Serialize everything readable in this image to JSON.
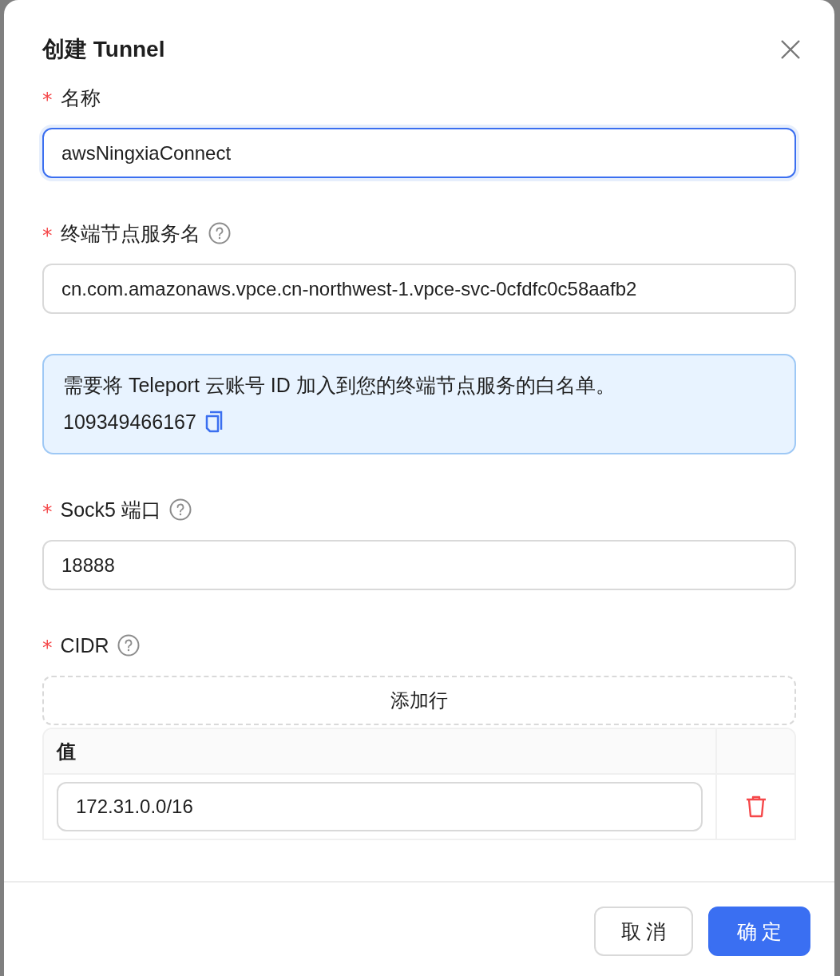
{
  "dialog": {
    "title": "创建 Tunnel"
  },
  "form": [
    {
      "kind": "input",
      "marker": "*",
      "label": "名称",
      "help": false,
      "value": "awsNingxiaConnect",
      "focused": true
    },
    {
      "kind": "input",
      "marker": "*",
      "label": "终端节点服务名",
      "help": true,
      "value": "cn.com.amazonaws.vpce.cn-northwest-1.vpce-svc-0cfdfc0c58aafb2",
      "focused": false
    },
    {
      "kind": "alert",
      "text": "需要将 Teleport 云账号 ID 加入到您的终端节点服务的白名单。",
      "account": "109349466167"
    },
    {
      "kind": "input",
      "marker": "*",
      "label": "Sock5 端口",
      "help": true,
      "value": "18888",
      "focused": false
    },
    {
      "kind": "table",
      "marker": "*",
      "label": "CIDR",
      "help": true,
      "add_button": "添加行",
      "columns": [
        "值"
      ],
      "rows": [
        {
          "value": "172.31.0.0/16"
        }
      ]
    }
  ],
  "buttons": [
    {
      "label": "取 消",
      "primary": false
    },
    {
      "label": "确 定",
      "primary": true
    }
  ]
}
